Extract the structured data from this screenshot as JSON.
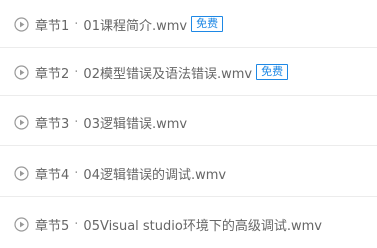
{
  "chapters": [
    {
      "label": "章节1",
      "separator": "·",
      "title": "01课程简介.wmv",
      "badge": "免费"
    },
    {
      "label": "章节2",
      "separator": "·",
      "title": "02模型错误及语法错误.wmv",
      "badge": "免费"
    },
    {
      "label": "章节3",
      "separator": "·",
      "title": "03逻辑错误.wmv"
    },
    {
      "label": "章节4",
      "separator": "·",
      "title": "04逻辑错误的调试.wmv"
    },
    {
      "label": "章节5",
      "separator": "·",
      "title": "05Visual studio环境下的高级调试.wmv"
    }
  ],
  "icons": {
    "play": "play-circle-icon"
  },
  "colors": {
    "text": "#666666",
    "icon": "#999999",
    "badge": "#1e88e5",
    "divider": "#ececec"
  }
}
